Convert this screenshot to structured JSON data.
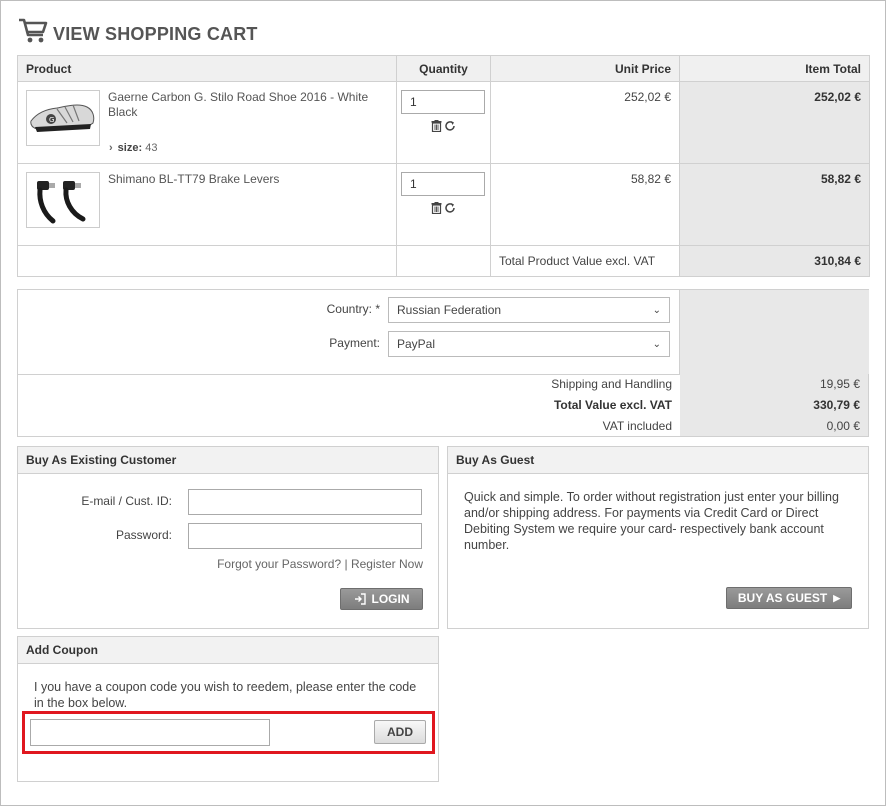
{
  "page": {
    "title": "VIEW SHOPPING CART"
  },
  "cart": {
    "columns": [
      "Product",
      "Quantity",
      "Unit Price",
      "Item Total"
    ],
    "items": [
      {
        "name": "Gaerne Carbon G. Stilo Road Shoe 2016 - White Black",
        "attr_label": "size:",
        "attr_value": "43",
        "quantity": "1",
        "unit_price": "252,02 €",
        "item_total": "252,02 €"
      },
      {
        "name": "Shimano BL-TT79 Brake Levers",
        "quantity": "1",
        "unit_price": "58,82 €",
        "item_total": "58,82 €"
      }
    ],
    "total_label": "Total Product Value excl. VAT",
    "total_value": "310,84 €"
  },
  "shipping": {
    "country_label": "Country: *",
    "country_value": "Russian Federation",
    "payment_label": "Payment:",
    "payment_value": "PayPal",
    "rows": [
      {
        "label": "Shipping and Handling",
        "value": "19,95 €"
      },
      {
        "label": "Total Value excl. VAT",
        "value": "330,79 €"
      },
      {
        "label": "VAT included",
        "value": "0,00 €"
      }
    ]
  },
  "existing": {
    "header": "Buy As Existing Customer",
    "email_label": "E-mail / Cust. ID:",
    "password_label": "Password:",
    "forgot_link": "Forgot your Password?",
    "separator": "|",
    "register_link": "Register Now",
    "login_button": "LOGIN"
  },
  "guest": {
    "header": "Buy As Guest",
    "text": "Quick and simple. To order without registration just enter your billing and/or shipping address. For payments via Credit Card or Direct Debiting System we require your card- respectively bank account number.",
    "button": "BUY AS GUEST"
  },
  "coupon": {
    "header": "Add Coupon",
    "text": "I you have a coupon code you wish to reedem, please enter the code in the box below.",
    "button": "ADD"
  },
  "colors": {
    "highlight": "#e0171f",
    "total_bg": "#e8e8e8"
  }
}
